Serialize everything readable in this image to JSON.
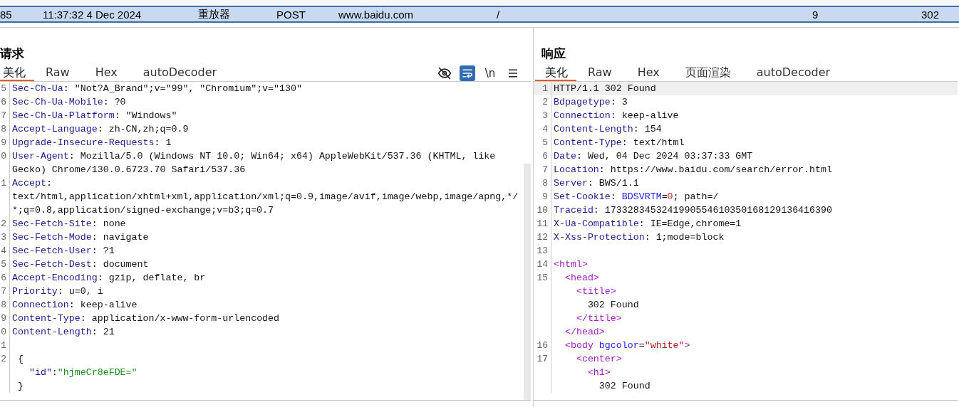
{
  "history_row": {
    "selected": true,
    "cells": [
      "85",
      "11:37:32 4 Dec 2024",
      "重放器",
      "POST",
      "www.baidu.com",
      "/",
      "9",
      "302"
    ]
  },
  "request": {
    "title": "请求",
    "tabs": [
      {
        "label": "美化",
        "selected": true
      },
      {
        "label": "Raw",
        "selected": false
      },
      {
        "label": "Hex",
        "selected": false
      },
      {
        "label": "autoDecoder",
        "selected": false
      }
    ],
    "tools": [
      {
        "kind": "hide",
        "on": false
      },
      {
        "kind": "wrap",
        "on": true
      },
      {
        "kind": "newline",
        "label": "\\n",
        "on": false
      },
      {
        "kind": "menu",
        "on": false
      }
    ],
    "lines": [
      {
        "num": "5",
        "segments": [
          {
            "kind": "key",
            "text": "Sec-Ch-Ua"
          },
          {
            "kind": "value",
            "text": ": \"Not?A_Brand\";v=\"99\", \"Chromium\";v=\"130\""
          }
        ]
      },
      {
        "num": "6",
        "segments": [
          {
            "kind": "key",
            "text": "Sec-Ch-Ua-Mobile"
          },
          {
            "kind": "value",
            "text": ": ?0"
          }
        ]
      },
      {
        "num": "7",
        "segments": [
          {
            "kind": "key",
            "text": "Sec-Ch-Ua-Platform"
          },
          {
            "kind": "value",
            "text": ": \"Windows\""
          }
        ]
      },
      {
        "num": "8",
        "segments": [
          {
            "kind": "key",
            "text": "Accept-Language"
          },
          {
            "kind": "value",
            "text": ": zh-CN,zh;q=0.9"
          }
        ]
      },
      {
        "num": "9",
        "segments": [
          {
            "kind": "key",
            "text": "Upgrade-Insecure-Requests"
          },
          {
            "kind": "value",
            "text": ": 1"
          }
        ]
      },
      {
        "num": "0",
        "segments": [
          {
            "kind": "key",
            "text": "User-Agent"
          },
          {
            "kind": "value",
            "text": ": Mozilla/5.0 (Windows NT 10.0; Win64; x64) AppleWebKit/537.36 (KHTML, like"
          }
        ]
      },
      {
        "segments": [
          {
            "kind": "value",
            "text": "Gecko) Chrome/130.0.6723.70 Safari/537.36"
          }
        ]
      },
      {
        "num": "1",
        "segments": [
          {
            "kind": "key",
            "text": "Accept"
          },
          {
            "kind": "value",
            "text": ":"
          }
        ]
      },
      {
        "segments": [
          {
            "kind": "value",
            "text": "text/html,application/xhtml+xml,application/xml;q=0.9,image/avif,image/webp,image/apng,*/"
          }
        ]
      },
      {
        "segments": [
          {
            "kind": "value",
            "text": "*;q=0.8,application/signed-exchange;v=b3;q=0.7"
          }
        ]
      },
      {
        "num": "2",
        "segments": [
          {
            "kind": "key",
            "text": "Sec-Fetch-Site"
          },
          {
            "kind": "value",
            "text": ": none"
          }
        ]
      },
      {
        "num": "3",
        "segments": [
          {
            "kind": "key",
            "text": "Sec-Fetch-Mode"
          },
          {
            "kind": "value",
            "text": ": navigate"
          }
        ]
      },
      {
        "num": "4",
        "segments": [
          {
            "kind": "key",
            "text": "Sec-Fetch-User"
          },
          {
            "kind": "value",
            "text": ": ?1"
          }
        ]
      },
      {
        "num": "5",
        "segments": [
          {
            "kind": "key",
            "text": "Sec-Fetch-Dest"
          },
          {
            "kind": "value",
            "text": ": document"
          }
        ]
      },
      {
        "num": "6",
        "segments": [
          {
            "kind": "key",
            "text": "Accept-Encoding"
          },
          {
            "kind": "value",
            "text": ": gzip, deflate, br"
          }
        ]
      },
      {
        "num": "7",
        "segments": [
          {
            "kind": "key",
            "text": "Priority"
          },
          {
            "kind": "value",
            "text": ": u=0, i"
          }
        ]
      },
      {
        "num": "8",
        "segments": [
          {
            "kind": "key",
            "text": "Connection"
          },
          {
            "kind": "value",
            "text": ": keep-alive"
          }
        ]
      },
      {
        "num": "9",
        "segments": [
          {
            "kind": "key",
            "text": "Content-Type"
          },
          {
            "kind": "value",
            "text": ": application/x-www-form-urlencoded"
          }
        ]
      },
      {
        "num": "0",
        "segments": [
          {
            "kind": "key",
            "text": "Content-Length"
          },
          {
            "kind": "value",
            "text": ": 21"
          }
        ]
      },
      {
        "num": "1"
      },
      {
        "num": "2",
        "segments": [
          {
            "kind": "value",
            "text": " {"
          }
        ]
      },
      {
        "segments": [
          {
            "kind": "key",
            "text": "   \"id\""
          },
          {
            "kind": "value",
            "text": ":"
          },
          {
            "kind": "string",
            "text": "\"hjmeCr8eFDE=\""
          }
        ]
      },
      {
        "segments": [
          {
            "kind": "value",
            "text": " }"
          }
        ]
      }
    ]
  },
  "response": {
    "title": "响应",
    "tabs": [
      {
        "label": "美化",
        "selected": true
      },
      {
        "label": "Raw",
        "selected": false
      },
      {
        "label": "Hex",
        "selected": false
      },
      {
        "label": "页面渲染",
        "selected": false
      },
      {
        "label": "autoDecoder",
        "selected": false
      }
    ],
    "lines": [
      {
        "num": "1",
        "highlighted": true,
        "segments": [
          {
            "kind": "value",
            "text": "HTTP/1.1 302 Found"
          }
        ]
      },
      {
        "num": "2",
        "highlighted": false,
        "segments": [
          {
            "kind": "key",
            "text": "Bdpagetype"
          },
          {
            "kind": "value",
            "text": ": 3"
          }
        ]
      },
      {
        "num": "3",
        "highlighted": false,
        "segments": [
          {
            "kind": "key",
            "text": "Connection"
          },
          {
            "kind": "value",
            "text": ": keep-alive"
          }
        ]
      },
      {
        "num": "4",
        "highlighted": false,
        "segments": [
          {
            "kind": "key",
            "text": "Content-Length"
          },
          {
            "kind": "value",
            "text": ": 154"
          }
        ]
      },
      {
        "num": "5",
        "highlighted": false,
        "segments": [
          {
            "kind": "key",
            "text": "Content-Type"
          },
          {
            "kind": "value",
            "text": ": text/html"
          }
        ]
      },
      {
        "num": "6",
        "highlighted": false,
        "segments": [
          {
            "kind": "key",
            "text": "Date"
          },
          {
            "kind": "value",
            "text": ": Wed, 04 Dec 2024 03:37:33 GMT"
          }
        ]
      },
      {
        "num": "7",
        "highlighted": false,
        "segments": [
          {
            "kind": "key",
            "text": "Location"
          },
          {
            "kind": "value",
            "text": ": https://www.baidu.com/search/error.html"
          }
        ]
      },
      {
        "num": "8",
        "highlighted": false,
        "segments": [
          {
            "kind": "key",
            "text": "Server"
          },
          {
            "kind": "value",
            "text": ": BWS/1.1"
          }
        ]
      },
      {
        "num": "9",
        "highlighted": false,
        "segments": [
          {
            "kind": "key",
            "text": "Set-Cookie"
          },
          {
            "kind": "value",
            "text": ": "
          },
          {
            "kind": "attr",
            "text": "BDSVRTM"
          },
          {
            "kind": "value",
            "text": "="
          },
          {
            "kind": "attrvalue",
            "text": "0"
          },
          {
            "kind": "value",
            "text": "; path=/"
          }
        ]
      },
      {
        "num": "10",
        "highlighted": false,
        "segments": [
          {
            "kind": "key",
            "text": "Traceid"
          },
          {
            "kind": "value",
            "text": ": 1733283453241990554610350168129136416390"
          }
        ]
      },
      {
        "num": "11",
        "highlighted": false,
        "segments": [
          {
            "kind": "key",
            "text": "X-Ua-Compatible"
          },
          {
            "kind": "value",
            "text": ": IE=Edge,chrome=1"
          }
        ]
      },
      {
        "num": "12",
        "highlighted": false,
        "segments": [
          {
            "kind": "key",
            "text": "X-Xss-Protection"
          },
          {
            "kind": "value",
            "text": ": 1;mode=block"
          }
        ]
      },
      {
        "num": "13",
        "highlighted": false
      },
      {
        "num": "14",
        "highlighted": false,
        "segments": [
          {
            "kind": "tag",
            "text": "<html>"
          }
        ]
      },
      {
        "num": "15",
        "highlighted": false,
        "segments": [
          {
            "kind": "tag",
            "text": "  <head>"
          }
        ]
      },
      {
        "highlighted": false,
        "segments": [
          {
            "kind": "tag",
            "text": "    <title>"
          }
        ]
      },
      {
        "highlighted": false,
        "segments": [
          {
            "kind": "value",
            "text": "      302 Found"
          }
        ]
      },
      {
        "highlighted": false,
        "segments": [
          {
            "kind": "tag",
            "text": "    </title>"
          }
        ]
      },
      {
        "highlighted": false,
        "segments": [
          {
            "kind": "tag",
            "text": "  </head>"
          }
        ]
      },
      {
        "num": "16",
        "highlighted": false,
        "segments": [
          {
            "kind": "tag",
            "text": "  <body "
          },
          {
            "kind": "attr",
            "text": "bgcolor"
          },
          {
            "kind": "value",
            "text": "="
          },
          {
            "kind": "attrvalue",
            "text": "\"white\""
          },
          {
            "kind": "tag",
            "text": ">"
          }
        ]
      },
      {
        "num": "17",
        "highlighted": false,
        "segments": [
          {
            "kind": "tag",
            "text": "    <center>"
          }
        ]
      },
      {
        "highlighted": false,
        "segments": [
          {
            "kind": "tag",
            "text": "      <h1>"
          }
        ]
      },
      {
        "highlighted": false,
        "segments": [
          {
            "kind": "value",
            "text": "        302 Found"
          }
        ]
      }
    ]
  }
}
